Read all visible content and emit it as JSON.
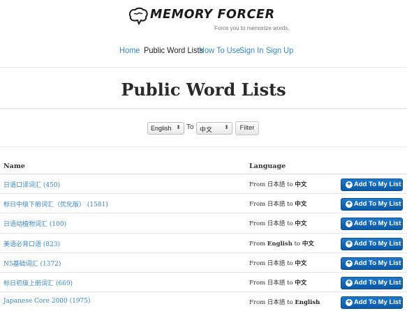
{
  "brand": {
    "name": "MEMORY FORCER",
    "tagline": "Force you to memorize words."
  },
  "nav": [
    {
      "label": "Home",
      "active": false
    },
    {
      "label": "Public Word Lists",
      "active": true
    },
    {
      "label": "How To Use",
      "active": false
    },
    {
      "label": "Sign In",
      "active": false
    },
    {
      "label": "Sign Up",
      "active": false
    }
  ],
  "page_title": "Public Word Lists",
  "filter": {
    "from_value": "English",
    "to_label": "To",
    "to_value": "中文",
    "button_label": "Filter"
  },
  "table": {
    "headers": {
      "name": "Name",
      "language": "Language"
    },
    "from_word": "From",
    "to_word": "to",
    "add_label": "Add To My List",
    "rows": [
      {
        "name": "日语口译词汇 (450)",
        "from": "日本語",
        "to": "中文",
        "from_bold": false
      },
      {
        "name": "标日中级下册词汇（优化版） (1581)",
        "from": "日本語",
        "to": "中文",
        "from_bold": false
      },
      {
        "name": "日语动植物词汇 (100)",
        "from": "日本語",
        "to": "中文",
        "from_bold": false
      },
      {
        "name": "美语必背口语 (823)",
        "from": "English",
        "to": "中文",
        "from_bold": true
      },
      {
        "name": "N5基础词汇 (1372)",
        "from": "日本語",
        "to": "中文",
        "from_bold": false
      },
      {
        "name": "标日初级上册词汇 (669)",
        "from": "日本語",
        "to": "中文",
        "from_bold": false
      },
      {
        "name": "Japanese Core 2000 (1975)",
        "from": "日本語",
        "to": "English",
        "from_bold": false
      }
    ]
  },
  "colors": {
    "link": "#3b88c3",
    "button": "#0b5aa6"
  }
}
